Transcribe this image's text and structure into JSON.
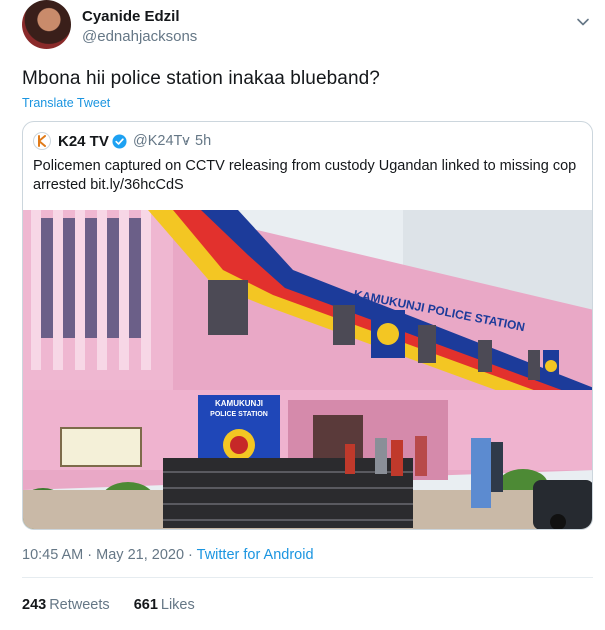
{
  "author": {
    "display_name": "Cyanide Edzil",
    "handle": "@ednahjacksons"
  },
  "tweet": {
    "text": "Mbona hii police station inakaa blueband?",
    "translate_label": "Translate Tweet"
  },
  "quote": {
    "name": "K24 TV",
    "handle": "@K24Tv",
    "separator": "·",
    "time": "5h",
    "text": "Policemen captured on CCTV releasing from custody Ugandan linked to missing cop arrested ",
    "link": "bit.ly/36hcCdS",
    "image": {
      "sign_main": "KAMUKUNJI POLICE STATION",
      "sign_banner_line1": "KAMUKUNJI",
      "sign_banner_line2": "POLICE STATION"
    }
  },
  "meta": {
    "time": "10:45 AM",
    "separator": " · ",
    "date": "May 21, 2020",
    "via": "Twitter for Android"
  },
  "stats": {
    "retweets_count": "243",
    "retweets_label": "Retweets",
    "likes_count": "661",
    "likes_label": "Likes"
  },
  "colors": {
    "link_blue": "#1b95e0",
    "secondary_text": "#657786",
    "border": "#ccd6dd",
    "verified_blue": "#1da1f2"
  }
}
